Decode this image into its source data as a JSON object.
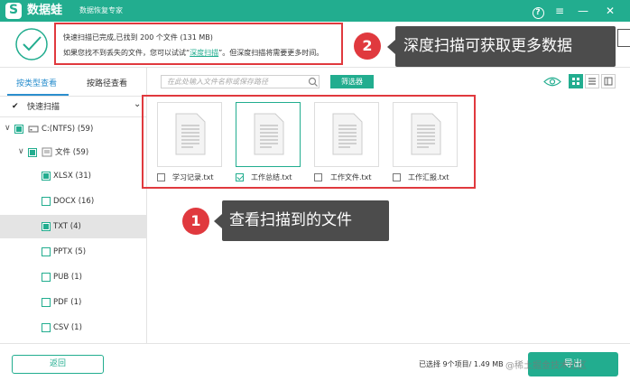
{
  "app": {
    "logo_char": "S",
    "name": "数据蛙",
    "subtitle": "数据恢复专家",
    "controls": {
      "help": "?",
      "menu": "≡",
      "minimize": "—",
      "close": "✕"
    }
  },
  "header": {
    "line1": "快速扫描已完成,已找到 200 个文件 (131 MB)",
    "line2_before": "如果您找不到丢失的文件，您可以试试“",
    "deep_scan_link": "深度扫描",
    "line2_after": "”。但深度扫描将需要更多时间。"
  },
  "sidebar": {
    "tabs": [
      "按类型查看",
      "按路径查看"
    ],
    "quick_scan": "快速扫描",
    "tree": [
      {
        "label": "C:(NTFS) (59)"
      },
      {
        "label": "文件 (59)"
      },
      {
        "label": "XLSX (31)"
      },
      {
        "label": "DOCX (16)"
      },
      {
        "label": "TXT (4)"
      },
      {
        "label": "PPTX (5)"
      },
      {
        "label": "PUB (1)"
      },
      {
        "label": "PDF (1)"
      },
      {
        "label": "CSV (1)"
      }
    ]
  },
  "toolbar": {
    "search_placeholder": "在此处输入文件名称或保存路径",
    "filter_label": "筛选器"
  },
  "files": [
    {
      "name": "学习记录.txt",
      "checked": false
    },
    {
      "name": "工作总结.txt",
      "checked": true
    },
    {
      "name": "工作文件.txt",
      "checked": false
    },
    {
      "name": "工作汇报.txt",
      "checked": false
    }
  ],
  "callouts": {
    "one": {
      "num": "1",
      "text": "查看扫描到的文件"
    },
    "two": {
      "num": "2",
      "text": "深度扫描可获取更多数据"
    }
  },
  "footer": {
    "back_label": "返回",
    "selection_info": "已选择 9个项目/ 1.49 MB",
    "export_label": "导出",
    "watermark": "@稀土掘金技术社区"
  },
  "colors": {
    "accent": "#22ad8f",
    "highlight": "#e0393e",
    "callout_bg": "#4c4c4c"
  }
}
